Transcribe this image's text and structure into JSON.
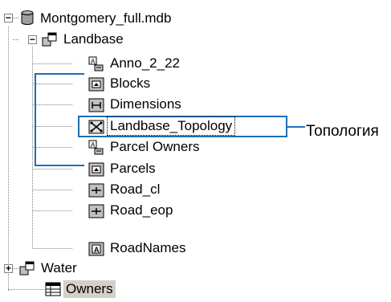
{
  "tree": {
    "root": {
      "label": "Montgomery_full.mdb",
      "expander": "−"
    },
    "landbase": {
      "label": "Landbase",
      "expander": "−"
    },
    "children": [
      {
        "label": "Anno_2_22",
        "icon": "annotation-icon"
      },
      {
        "label": "Blocks",
        "icon": "polygon-feature-icon"
      },
      {
        "label": "Dimensions",
        "icon": "dimension-icon"
      },
      {
        "label": "Landbase_Topology",
        "icon": "topology-icon"
      },
      {
        "label": "Parcel Owners",
        "icon": "annotation-icon"
      },
      {
        "label": "Parcels",
        "icon": "polygon-feature-icon"
      },
      {
        "label": "Road_cl",
        "icon": "line-feature-icon"
      },
      {
        "label": "Road_eop",
        "icon": "line-feature-icon"
      },
      {
        "label": "RoadNames",
        "icon": "annotation-text-icon"
      }
    ],
    "water": {
      "label": "Water",
      "expander": "+"
    },
    "owners": {
      "label": "Owners",
      "icon": "table-icon"
    }
  },
  "callout": {
    "label": "Топология",
    "color": "#1f6fb5"
  }
}
